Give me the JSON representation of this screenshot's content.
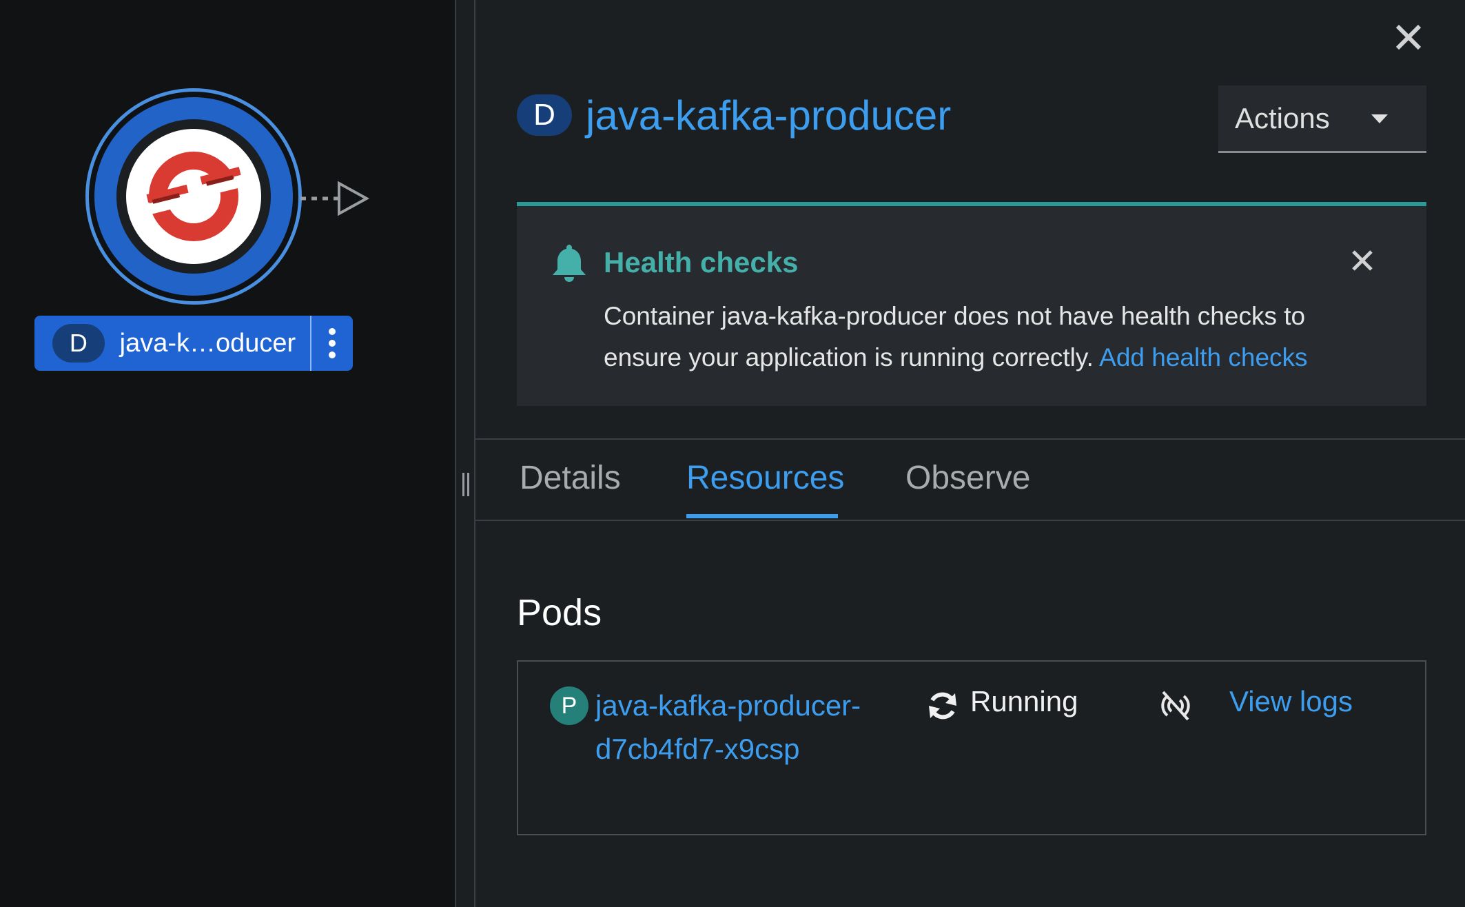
{
  "topology": {
    "node": {
      "badge": "D",
      "label": "java-k…oducer",
      "icon": "openshift-logo-icon"
    }
  },
  "panel": {
    "title_badge": "D",
    "title": "java-kafka-producer",
    "actions_label": "Actions",
    "alert": {
      "title": "Health checks",
      "message": "Container java-kafka-producer does not have health checks to ensure your application is running correctly.",
      "link": "Add health checks"
    },
    "tabs": [
      {
        "label": "Details",
        "active": false
      },
      {
        "label": "Resources",
        "active": true
      },
      {
        "label": "Observe",
        "active": false
      }
    ],
    "pods": {
      "heading": "Pods",
      "items": [
        {
          "badge": "P",
          "name": "java-kafka-producer-d7cb4fd7-x9csp",
          "status": "Running",
          "view_logs": "View logs"
        }
      ]
    }
  },
  "colors": {
    "accent_blue": "#3d9ef0",
    "node_blue": "#1f64d2",
    "alert_teal": "#2b9a96",
    "logo_red": "#d93a32"
  }
}
